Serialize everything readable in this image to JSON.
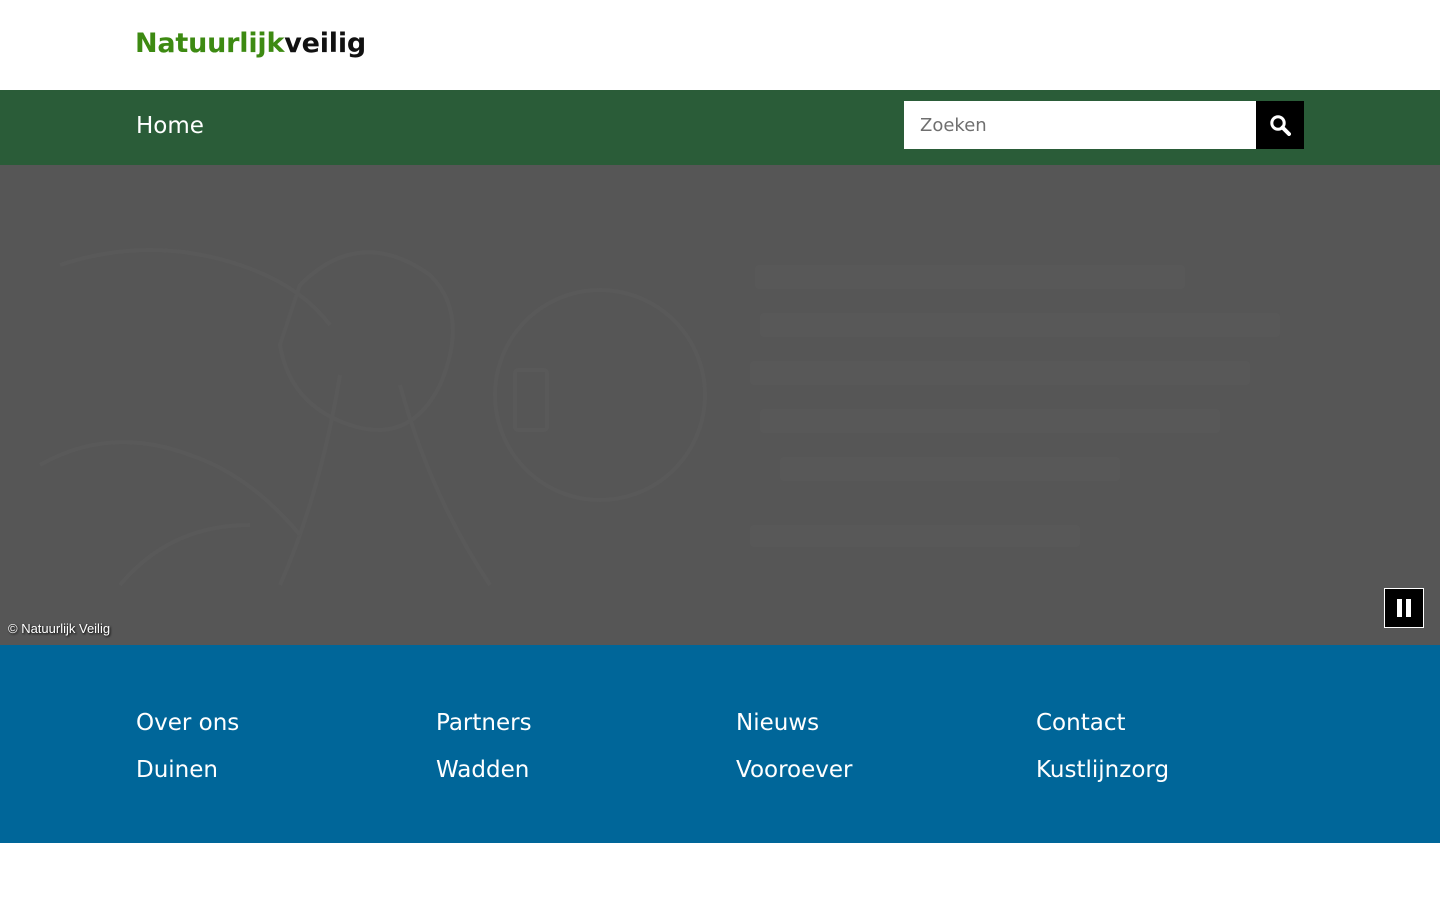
{
  "header": {
    "logo_part1": "Natuurlijk",
    "logo_part2": "veilig"
  },
  "nav": {
    "home_label": "Home"
  },
  "search": {
    "placeholder": "Zoeken",
    "button_icon": "search-icon"
  },
  "hero": {
    "caption": "© Natuurlijk Veilig",
    "pause_icon": "pause-icon"
  },
  "footer": {
    "links": [
      {
        "label": "Over ons"
      },
      {
        "label": "Partners"
      },
      {
        "label": "Nieuws"
      },
      {
        "label": "Contact"
      },
      {
        "label": "Duinen"
      },
      {
        "label": "Wadden"
      },
      {
        "label": "Vooroever"
      },
      {
        "label": "Kustlijnzorg"
      }
    ]
  },
  "colors": {
    "logo_green": "#3d8a12",
    "nav_background": "#2a5c38",
    "hero_overlay": "#565656",
    "footer_background": "#006699"
  }
}
